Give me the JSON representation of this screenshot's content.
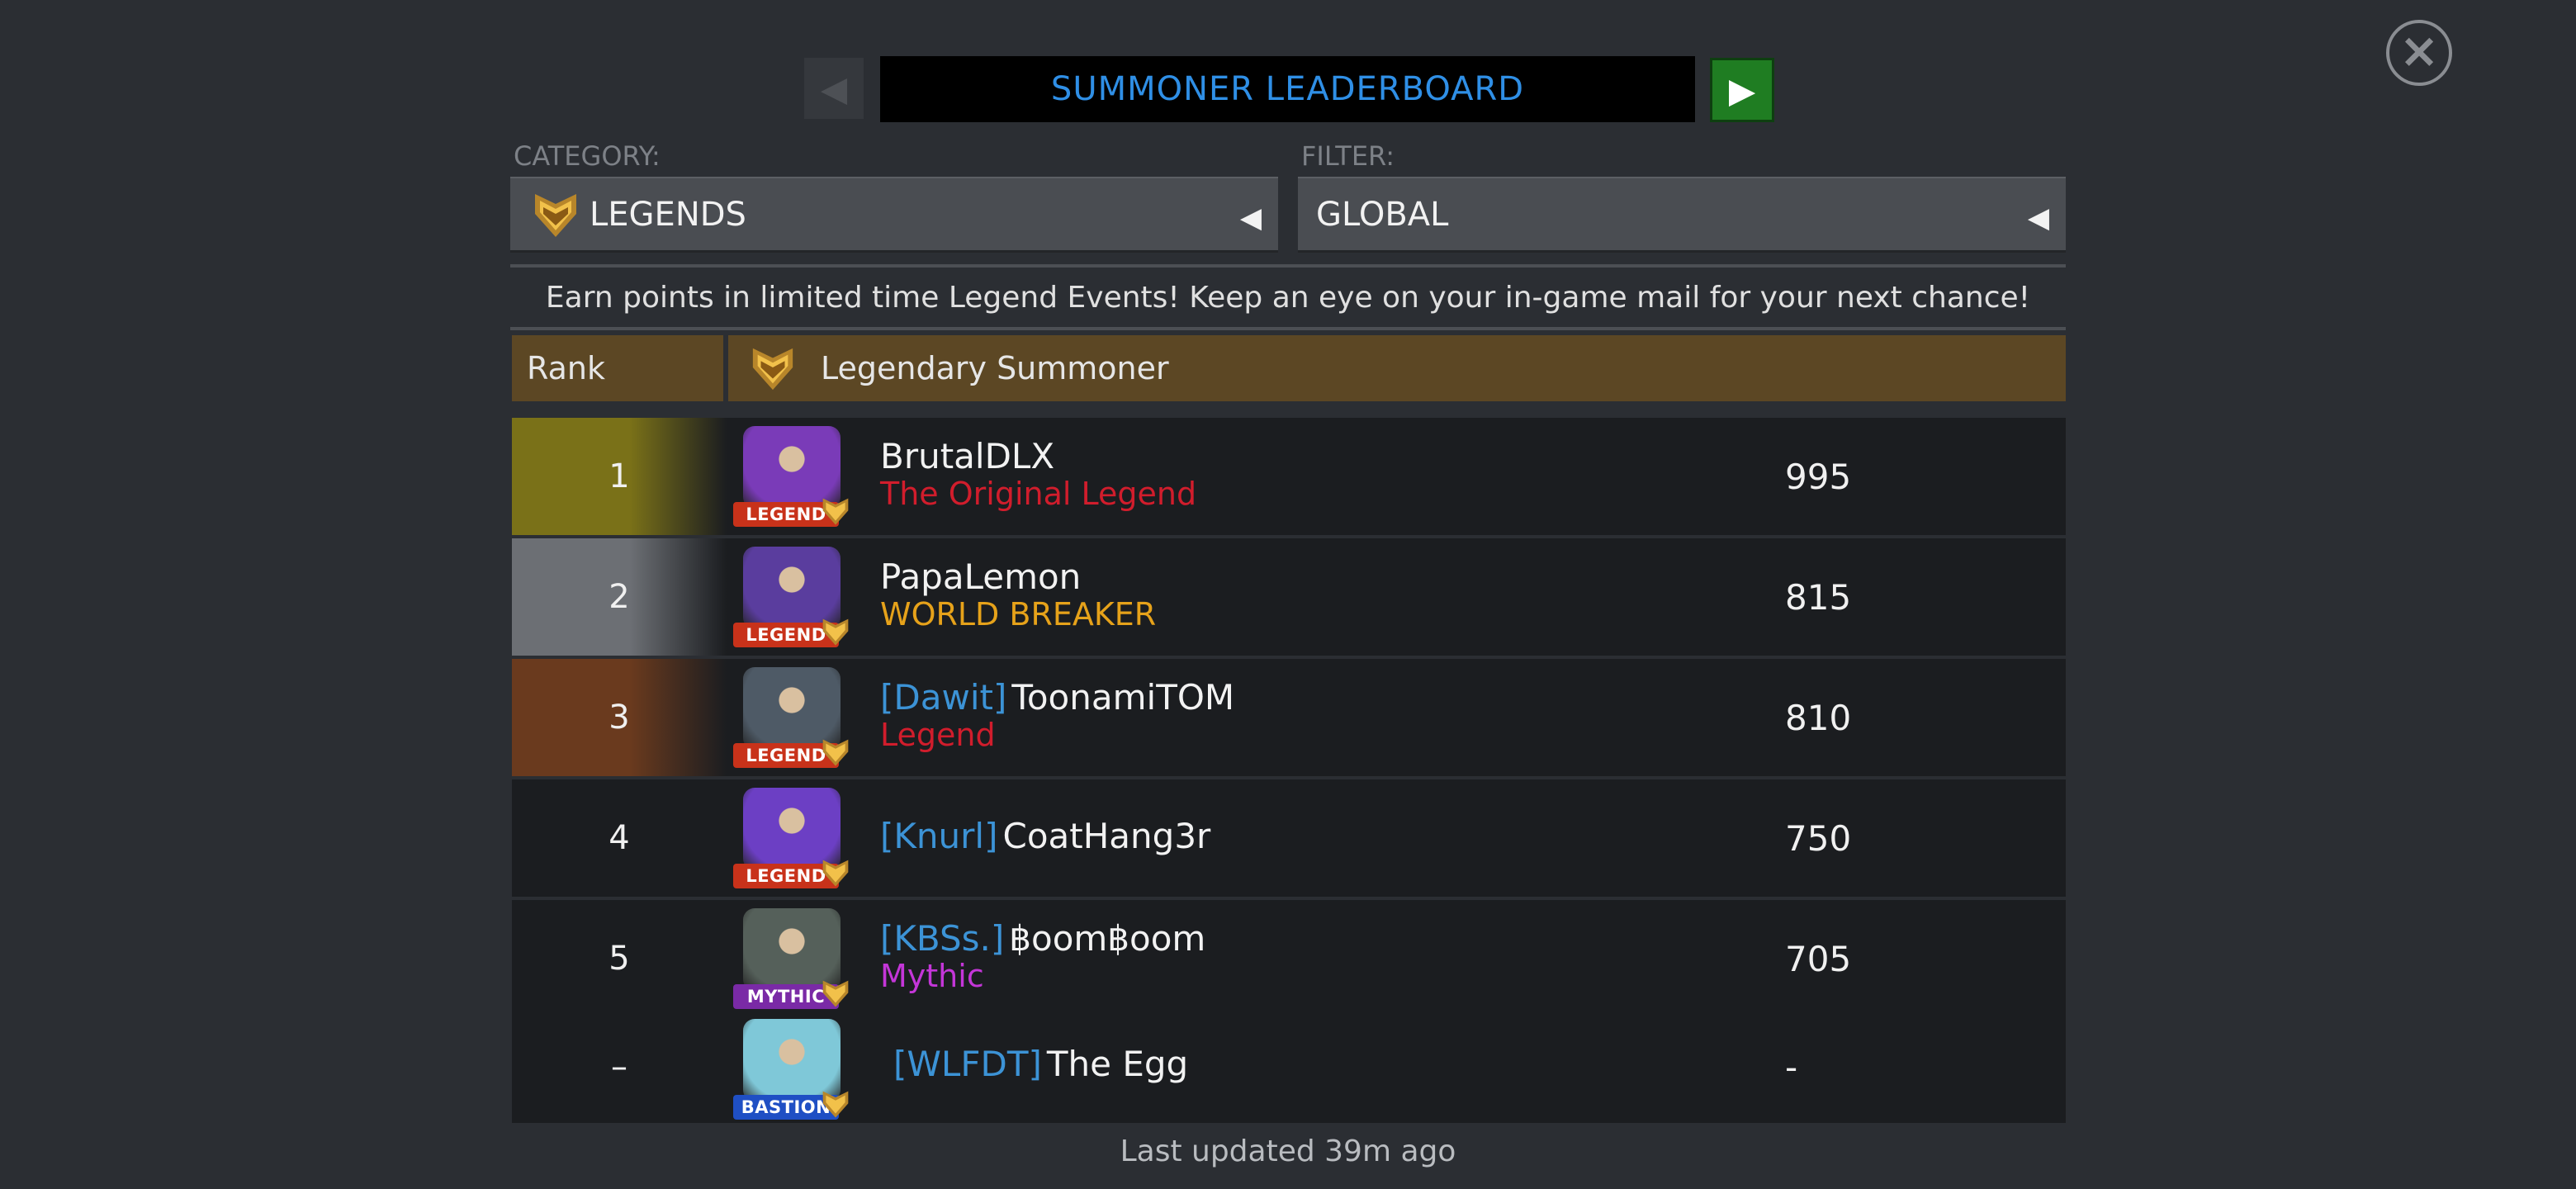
{
  "header": {
    "title": "SUMMONER LEADERBOARD",
    "prev_icon": "◀",
    "next_icon": "▶",
    "close_icon": "×"
  },
  "category": {
    "label": "CATEGORY:",
    "value": "LEGENDS",
    "arrow": "◀"
  },
  "filter": {
    "label": "FILTER:",
    "value": "GLOBAL",
    "arrow": "◀"
  },
  "info": "Earn points in limited time Legend Events! Keep an eye on your in-game mail for your next chance!",
  "table_header": {
    "rank": "Rank",
    "title": "Legendary Summoner"
  },
  "rows": [
    {
      "rank": "1",
      "tag": "",
      "name": "BrutalDLX",
      "subtitle": "The Original Legend",
      "subtitle_color": "#d11d2c",
      "badge": "LEGEND",
      "badge_color": "#c8321a",
      "portrait_color": "#7a3bb8",
      "score": "995",
      "rank_color": "#7a7118"
    },
    {
      "rank": "2",
      "tag": "",
      "name": "PapaLemon",
      "subtitle": "WORLD BREAKER",
      "subtitle_color": "#e6a21a",
      "badge": "LEGEND",
      "badge_color": "#c8321a",
      "portrait_color": "#5a3d9e",
      "score": "815",
      "rank_color": "#6c6f74"
    },
    {
      "rank": "3",
      "tag": "[Dawit]",
      "name": "ToonamiTOM",
      "subtitle": "Legend",
      "subtitle_color": "#d11d2c",
      "badge": "LEGEND",
      "badge_color": "#c8321a",
      "portrait_color": "#4e5a66",
      "score": "810",
      "rank_color": "#6a3a1e"
    },
    {
      "rank": "4",
      "tag": "[Knurl]",
      "name": "CoatHang3r",
      "subtitle": "",
      "subtitle_color": "#d11d2c",
      "badge": "LEGEND",
      "badge_color": "#c8321a",
      "portrait_color": "#6c3fc4",
      "score": "750",
      "rank_color": ""
    },
    {
      "rank": "5",
      "tag": "[KBSs.]",
      "name": "฿oom฿oom",
      "subtitle": "Mythic",
      "subtitle_color": "#c436d8",
      "badge": "MYTHIC",
      "badge_color": "#7a2aa6",
      "portrait_color": "#55605a",
      "score": "705",
      "rank_color": ""
    },
    {
      "rank": "–",
      "tag": "[WLFDT]",
      "name": "The Egg",
      "subtitle": "",
      "subtitle_color": "#d11d2c",
      "badge": "BASTION",
      "badge_color": "#1f4fc4",
      "portrait_color": "#7fc8d8",
      "score": "-",
      "rank_color": ""
    }
  ],
  "footer": "Last updated 39m ago"
}
